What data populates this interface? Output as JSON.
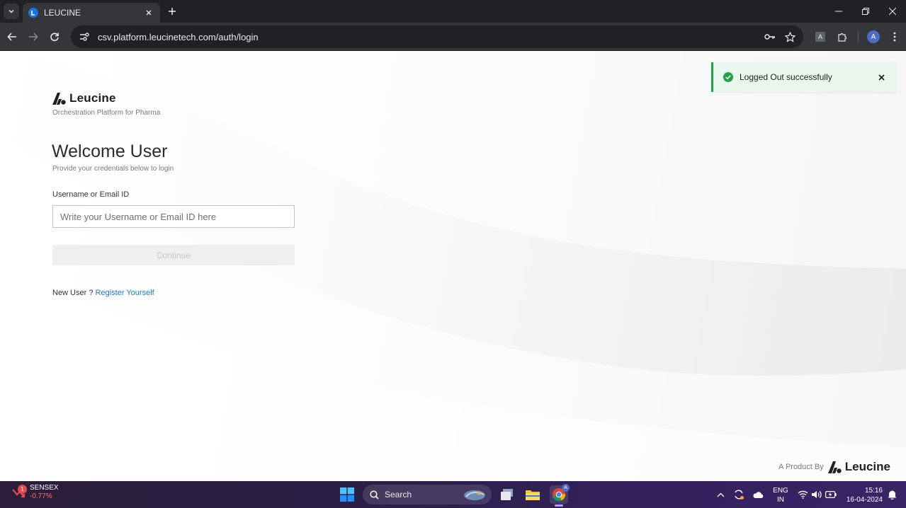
{
  "browser": {
    "tab_title": "LEUCINE",
    "url": "csv.platform.leucinetech.com/auth/login",
    "profile_initial": "A",
    "translate_label": "A"
  },
  "page": {
    "brand_name": "Leucine",
    "brand_tagline": "Orchestration Platform for Pharma",
    "welcome_title": "Welcome User",
    "welcome_subtitle": "Provide your credentials below to login",
    "username_label": "Username or Email ID",
    "username_placeholder": "Write your Username or Email ID here",
    "continue_label": "Continue",
    "new_user_text": "New User ?",
    "register_link": "Register Yourself",
    "footer_prefix": "A Product By",
    "footer_brand": "Leucine"
  },
  "toast": {
    "message": "Logged Out successfully",
    "accent_color": "#24a148"
  },
  "taskbar": {
    "ticker_badge": "1",
    "ticker_name": "SENSEX",
    "ticker_value": "-0.77%",
    "search_label": "Search",
    "chrome_badge": "A",
    "lang_line1": "ENG",
    "lang_line2": "IN",
    "time": "15:16",
    "date": "16-04-2024"
  }
}
